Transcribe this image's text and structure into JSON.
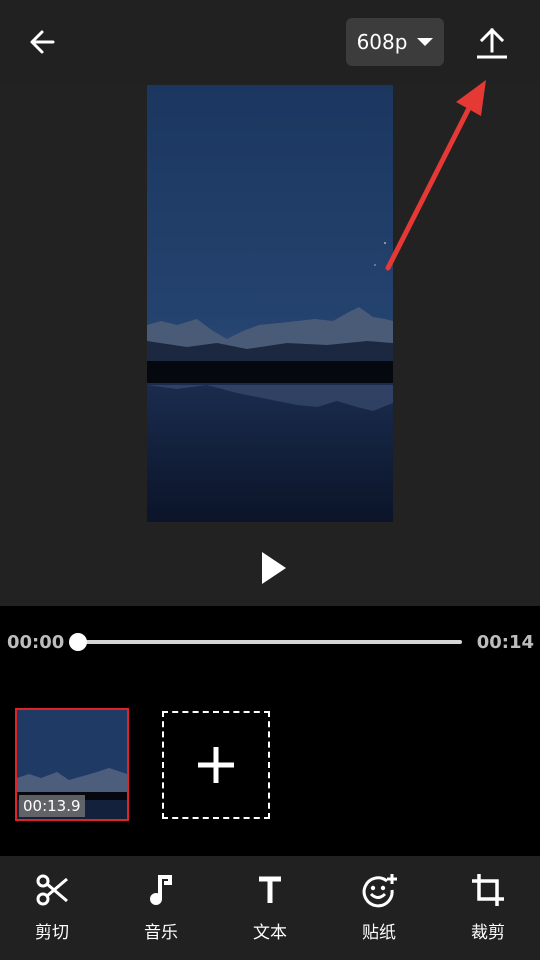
{
  "header": {
    "resolution": "608p"
  },
  "player": {
    "current_time": "00:00",
    "duration": "00:14",
    "progress": 0
  },
  "clips": [
    {
      "duration": "00:13.9",
      "selected": true
    }
  ],
  "toolbar": {
    "items": [
      {
        "icon": "scissors-icon",
        "label": "剪切"
      },
      {
        "icon": "music-note-icon",
        "label": "音乐"
      },
      {
        "icon": "text-icon",
        "label": "文本"
      },
      {
        "icon": "sticker-icon",
        "label": "贴纸"
      },
      {
        "icon": "crop-icon",
        "label": "裁剪"
      }
    ]
  },
  "colors": {
    "selection": "#e02424",
    "annotation_arrow": "#e53935",
    "bar_background": "#212121"
  }
}
